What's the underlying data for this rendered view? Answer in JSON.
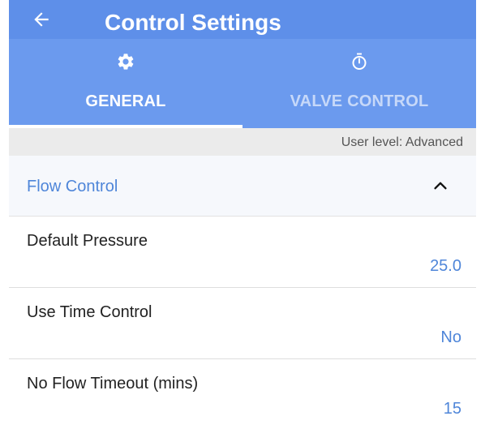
{
  "appbar": {
    "title": "Control Settings"
  },
  "tabs": [
    {
      "label": "GENERAL",
      "icon": "gear-icon",
      "selected": true
    },
    {
      "label": "VALVE CONTROL",
      "icon": "stopwatch-icon",
      "selected": false
    }
  ],
  "user_level": "User level: Advanced",
  "section": {
    "title": "Flow Control",
    "expanded": true
  },
  "settings": [
    {
      "label": "Default Pressure",
      "value": "25.0"
    },
    {
      "label": "Use Time Control",
      "value": "No"
    },
    {
      "label": "No Flow Timeout (mins)",
      "value": "15"
    }
  ],
  "colors": {
    "appbar": "#5e8fe9",
    "tabbar": "#6b9aee",
    "accent_text": "#4f86d9",
    "userlevel_bar": "#ebebeb"
  }
}
